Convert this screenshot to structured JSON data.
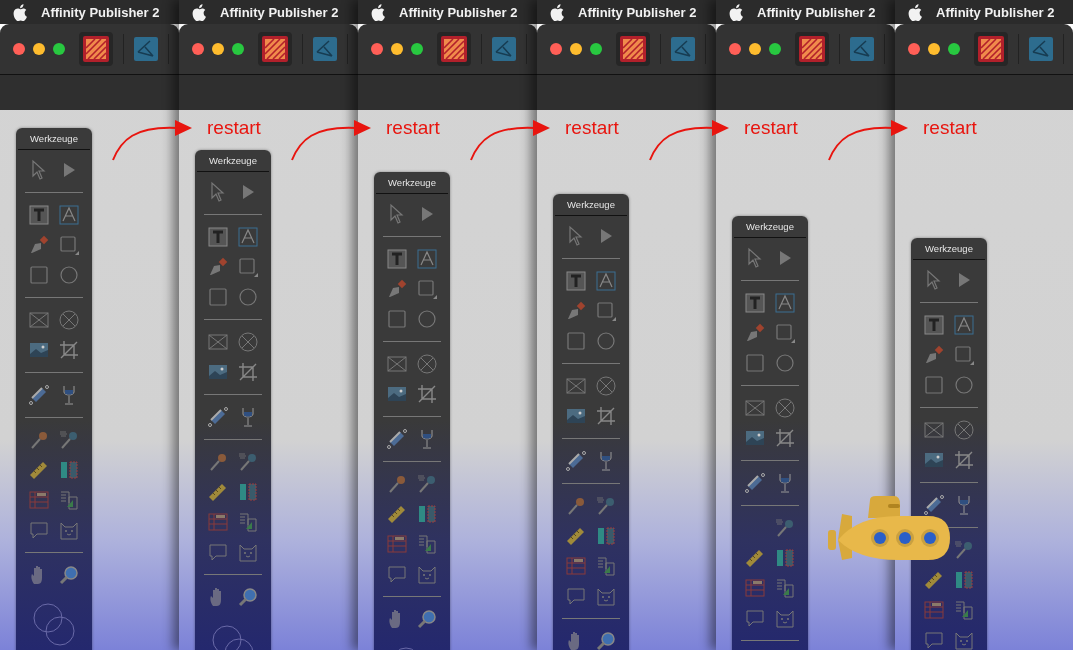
{
  "screens": [
    {
      "menu_title": "Affinity Publisher 2",
      "panel_title": "Werkzeuge"
    },
    {
      "menu_title": "Affinity Publisher 2",
      "panel_title": "Werkzeuge"
    },
    {
      "menu_title": "Affinity Publisher 2",
      "panel_title": "Werkzeuge"
    },
    {
      "menu_title": "Affinity Publisher 2",
      "panel_title": "Werkzeuge"
    },
    {
      "menu_title": "Affinity Publisher 2",
      "panel_title": "Werkzeuge"
    },
    {
      "menu_title": "Affinity Publisher 2",
      "panel_title": "Werkzeuge"
    }
  ],
  "arrows": [
    {
      "label": "restart"
    },
    {
      "label": "restart"
    },
    {
      "label": "restart"
    },
    {
      "label": "restart"
    },
    {
      "label": "restart"
    }
  ]
}
